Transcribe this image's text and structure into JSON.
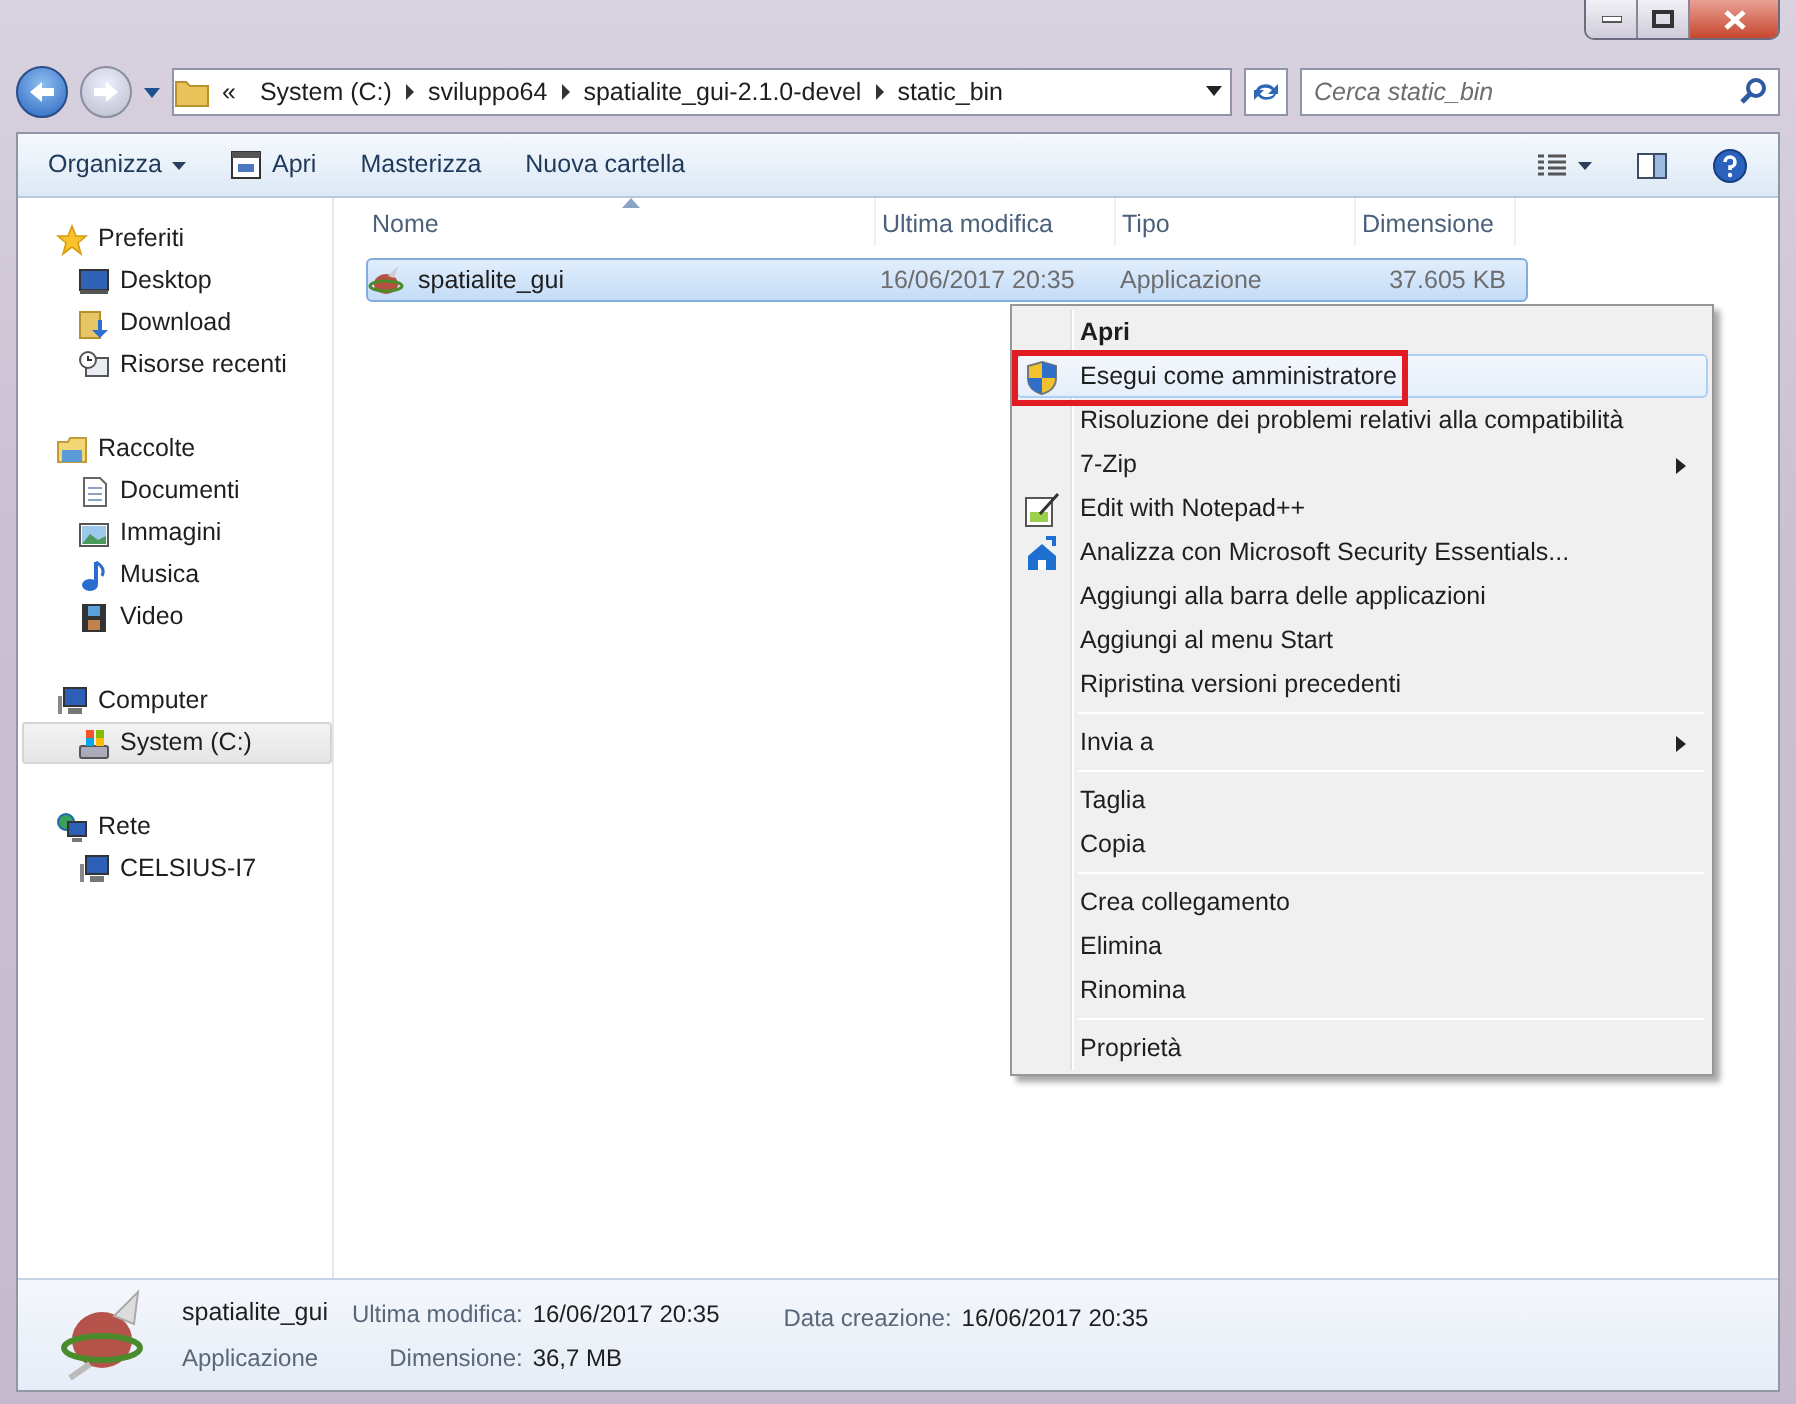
{
  "navigation": {
    "breadcrumb": [
      "«",
      "System (C:)",
      "sviluppo64",
      "spatialite_gui-2.1.0-devel",
      "static_bin"
    ],
    "search": {
      "placeholder": "Cerca static_bin"
    }
  },
  "toolbar": {
    "buttons": [
      {
        "label": "Organizza",
        "dropdown": true
      },
      {
        "label": "Apri",
        "dropdown": false
      },
      {
        "label": "Masterizza",
        "dropdown": false
      },
      {
        "label": "Nuova cartella",
        "dropdown": false
      }
    ]
  },
  "sidebar": {
    "groups": [
      {
        "label": "Preferiti",
        "selected": false,
        "children": [
          {
            "label": "Desktop",
            "selected": false
          },
          {
            "label": "Download",
            "selected": false
          },
          {
            "label": "Risorse recenti",
            "selected": false
          }
        ]
      },
      {
        "label": "Raccolte",
        "selected": false,
        "children": [
          {
            "label": "Documenti",
            "selected": false
          },
          {
            "label": "Immagini",
            "selected": false
          },
          {
            "label": "Musica",
            "selected": false
          },
          {
            "label": "Video",
            "selected": false
          }
        ]
      },
      {
        "label": "Computer",
        "selected": false,
        "children": [
          {
            "label": "System (C:)",
            "selected": true
          }
        ]
      },
      {
        "label": "Rete",
        "selected": false,
        "children": [
          {
            "label": "CELSIUS-I7",
            "selected": false
          }
        ]
      }
    ]
  },
  "file_list": {
    "columns": [
      {
        "label": "Nome",
        "sorted": true
      },
      {
        "label": "Ultima modifica",
        "sorted": false
      },
      {
        "label": "Tipo",
        "sorted": false
      },
      {
        "label": "Dimensione",
        "sorted": false
      }
    ],
    "rows": [
      {
        "cells": [
          "spatialite_gui",
          "16/06/2017 20:35",
          "Applicazione",
          "37.605 KB"
        ],
        "selected": true
      }
    ]
  },
  "context_menu": {
    "items": [
      {
        "kind": "item",
        "label": "Apri",
        "default": true,
        "selected": false,
        "submenu": false,
        "annotated": false
      },
      {
        "kind": "item",
        "label": "Esegui come amministratore",
        "default": false,
        "selected": true,
        "submenu": false,
        "annotated": true
      },
      {
        "kind": "item",
        "label": "Risoluzione dei problemi relativi alla compatibilità",
        "default": false,
        "selected": false,
        "submenu": false,
        "annotated": false
      },
      {
        "kind": "item",
        "label": "7-Zip",
        "default": false,
        "selected": false,
        "submenu": true,
        "annotated": false
      },
      {
        "kind": "item",
        "label": "Edit with Notepad++",
        "default": false,
        "selected": false,
        "submenu": false,
        "annotated": false
      },
      {
        "kind": "item",
        "label": "Analizza con Microsoft Security Essentials...",
        "default": false,
        "selected": false,
        "submenu": false,
        "annotated": false
      },
      {
        "kind": "item",
        "label": "Aggiungi alla barra delle applicazioni",
        "default": false,
        "selected": false,
        "submenu": false,
        "annotated": false
      },
      {
        "kind": "item",
        "label": "Aggiungi al menu Start",
        "default": false,
        "selected": false,
        "submenu": false,
        "annotated": false
      },
      {
        "kind": "item",
        "label": "Ripristina versioni precedenti",
        "default": false,
        "selected": false,
        "submenu": false,
        "annotated": false
      },
      {
        "kind": "separator"
      },
      {
        "kind": "item",
        "label": "Invia a",
        "default": false,
        "selected": false,
        "submenu": true,
        "annotated": false
      },
      {
        "kind": "separator"
      },
      {
        "kind": "item",
        "label": "Taglia",
        "default": false,
        "selected": false,
        "submenu": false,
        "annotated": false
      },
      {
        "kind": "item",
        "label": "Copia",
        "default": false,
        "selected": false,
        "submenu": false,
        "annotated": false
      },
      {
        "kind": "separator"
      },
      {
        "kind": "item",
        "label": "Crea collegamento",
        "default": false,
        "selected": false,
        "submenu": false,
        "annotated": false
      },
      {
        "kind": "item",
        "label": "Elimina",
        "default": false,
        "selected": false,
        "submenu": false,
        "annotated": false
      },
      {
        "kind": "item",
        "label": "Rinomina",
        "default": false,
        "selected": false,
        "submenu": false,
        "annotated": false
      },
      {
        "kind": "separator"
      },
      {
        "kind": "item",
        "label": "Proprietà",
        "default": false,
        "selected": false,
        "submenu": false,
        "annotated": false
      }
    ]
  },
  "details_pane": {
    "name": "spatialite_gui",
    "type": "Applicazione",
    "field_columns": [
      [
        {
          "label": "Ultima modifica:",
          "value": "16/06/2017 20:35"
        },
        {
          "label": "Dimensione:",
          "value": "36,7 MB"
        }
      ],
      [
        {
          "label": "Data creazione:",
          "value": "16/06/2017 20:35"
        }
      ]
    ]
  }
}
